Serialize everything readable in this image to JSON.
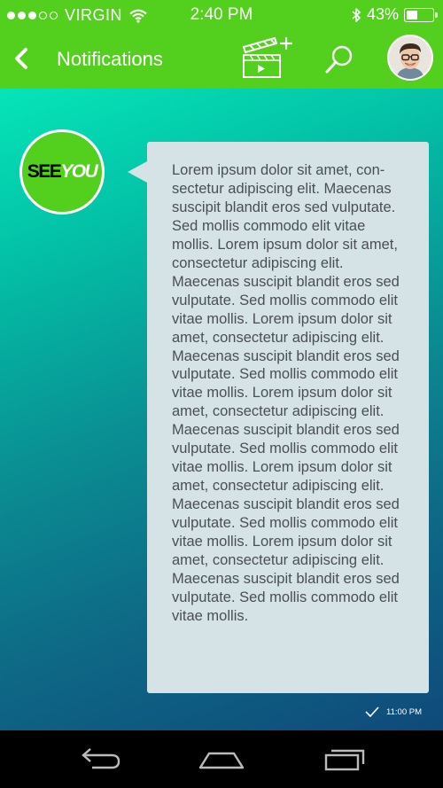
{
  "status_bar": {
    "carrier": "VIRGIN",
    "time": "2:40 PM",
    "battery_percent": "43%",
    "battery_level": 0.43,
    "signal_dots": 5,
    "signal_filled": 3
  },
  "header": {
    "title": "Notifications",
    "icons": [
      "back-chevron-icon",
      "clapperboard-add-icon",
      "search-icon",
      "avatar"
    ]
  },
  "message": {
    "sender_logo": {
      "see": "SEE",
      "you": "YOU"
    },
    "text": "Lorem ipsum dolor sit amet, con­sectetur adipiscing elit. Maece­nas suscipit blandit eros sed vulputate. Sed mollis commodo elit vitae mollis. Lorem ipsum dolor sit amet, consectetur adipi­scing elit. Maecenas suscipit blandit eros sed vulputate. Sed mollis commodo elit vitae mollis. Lorem ipsum dolor sit amet, con­sectetur adipiscing elit. Maece­nas suscipit blandit eros sed vulputate. Sed mollis commodo elit vitae mollis. Lorem ipsum dolor sit amet, consectetur adipi­scing elit. Maecenas suscipit blandit eros sed vulputate. Sed mollis commodo elit vitae mollis. Lorem ipsum dolor sit amet, con­sectetur adipiscing elit. Maece­nas suscipit blandit eros sed vulputate. Sed mollis commodo elit vitae mollis. Lorem ipsum dolor sit amet, consectetur adipi­scing elit. Maecenas suscipit blandit eros sed vulputate. Sed mollis commodo elit vitae mollis.",
    "time": "11:00 PM",
    "status_icon": "checkmark-icon"
  },
  "nav_bar": {
    "icons": [
      "back-arrow-icon",
      "home-icon",
      "recent-apps-icon"
    ]
  },
  "colors": {
    "brand_green": "#53cf1e",
    "bubble": "#d5e3e7",
    "gradient_start": "#06e5b8",
    "gradient_end": "#0f4a7a"
  }
}
